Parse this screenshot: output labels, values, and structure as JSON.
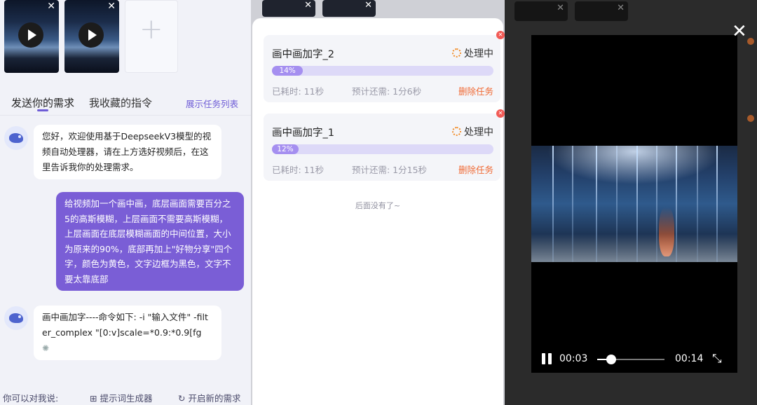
{
  "left_panel": {
    "tabs": {
      "send": "发送你的需求",
      "favorites": "我收藏的指令"
    },
    "show_task_list": "展示任务列表",
    "messages": [
      {
        "role": "bot",
        "text": "您好，欢迎使用基于DeepseekV3模型的视频自动处理器，请在上方选好视频后，在这里告诉我你的处理需求。"
      },
      {
        "role": "user",
        "text": "给视频加一个画中画，底层画面需要百分之5的高斯模糊，上层画面不需要高斯模糊，上层画面在底层模糊画面的中间位置，大小为原来的90%，底部再加上\"好物分享\"四个字，颜色为黄色，文字边框为黑色，文字不要太靠底部"
      },
      {
        "role": "bot",
        "text": "画中画加字----命令如下: -i \"输入文件\" -filter_complex \"[0:v]scale=*0.9:*0.9[fg"
      }
    ],
    "footer": {
      "hint": "你可以对我说:",
      "prompt_gen": "提示词生成器",
      "new_request": "开启新的需求"
    }
  },
  "task_panel": {
    "tasks": [
      {
        "name": "画中画加字_2",
        "status": "处理中",
        "progress_label": "14%",
        "progress": 0.14,
        "elapsed": "已耗时: 11秒",
        "remaining": "预计还需: 1分6秒",
        "delete": "删除任务"
      },
      {
        "name": "画中画加字_1",
        "status": "处理中",
        "progress_label": "12%",
        "progress": 0.12,
        "elapsed": "已耗时: 11秒",
        "remaining": "预计还需: 1分15秒",
        "delete": "删除任务"
      }
    ],
    "no_more": "后面没有了~"
  },
  "player": {
    "current_time": "00:03",
    "duration": "00:14",
    "progress": 0.21
  },
  "colors": {
    "accent": "#6e5cd6",
    "user_bubble": "#7a5ed6",
    "progress_fill": "#a58ff0",
    "delete": "#f06a35"
  }
}
